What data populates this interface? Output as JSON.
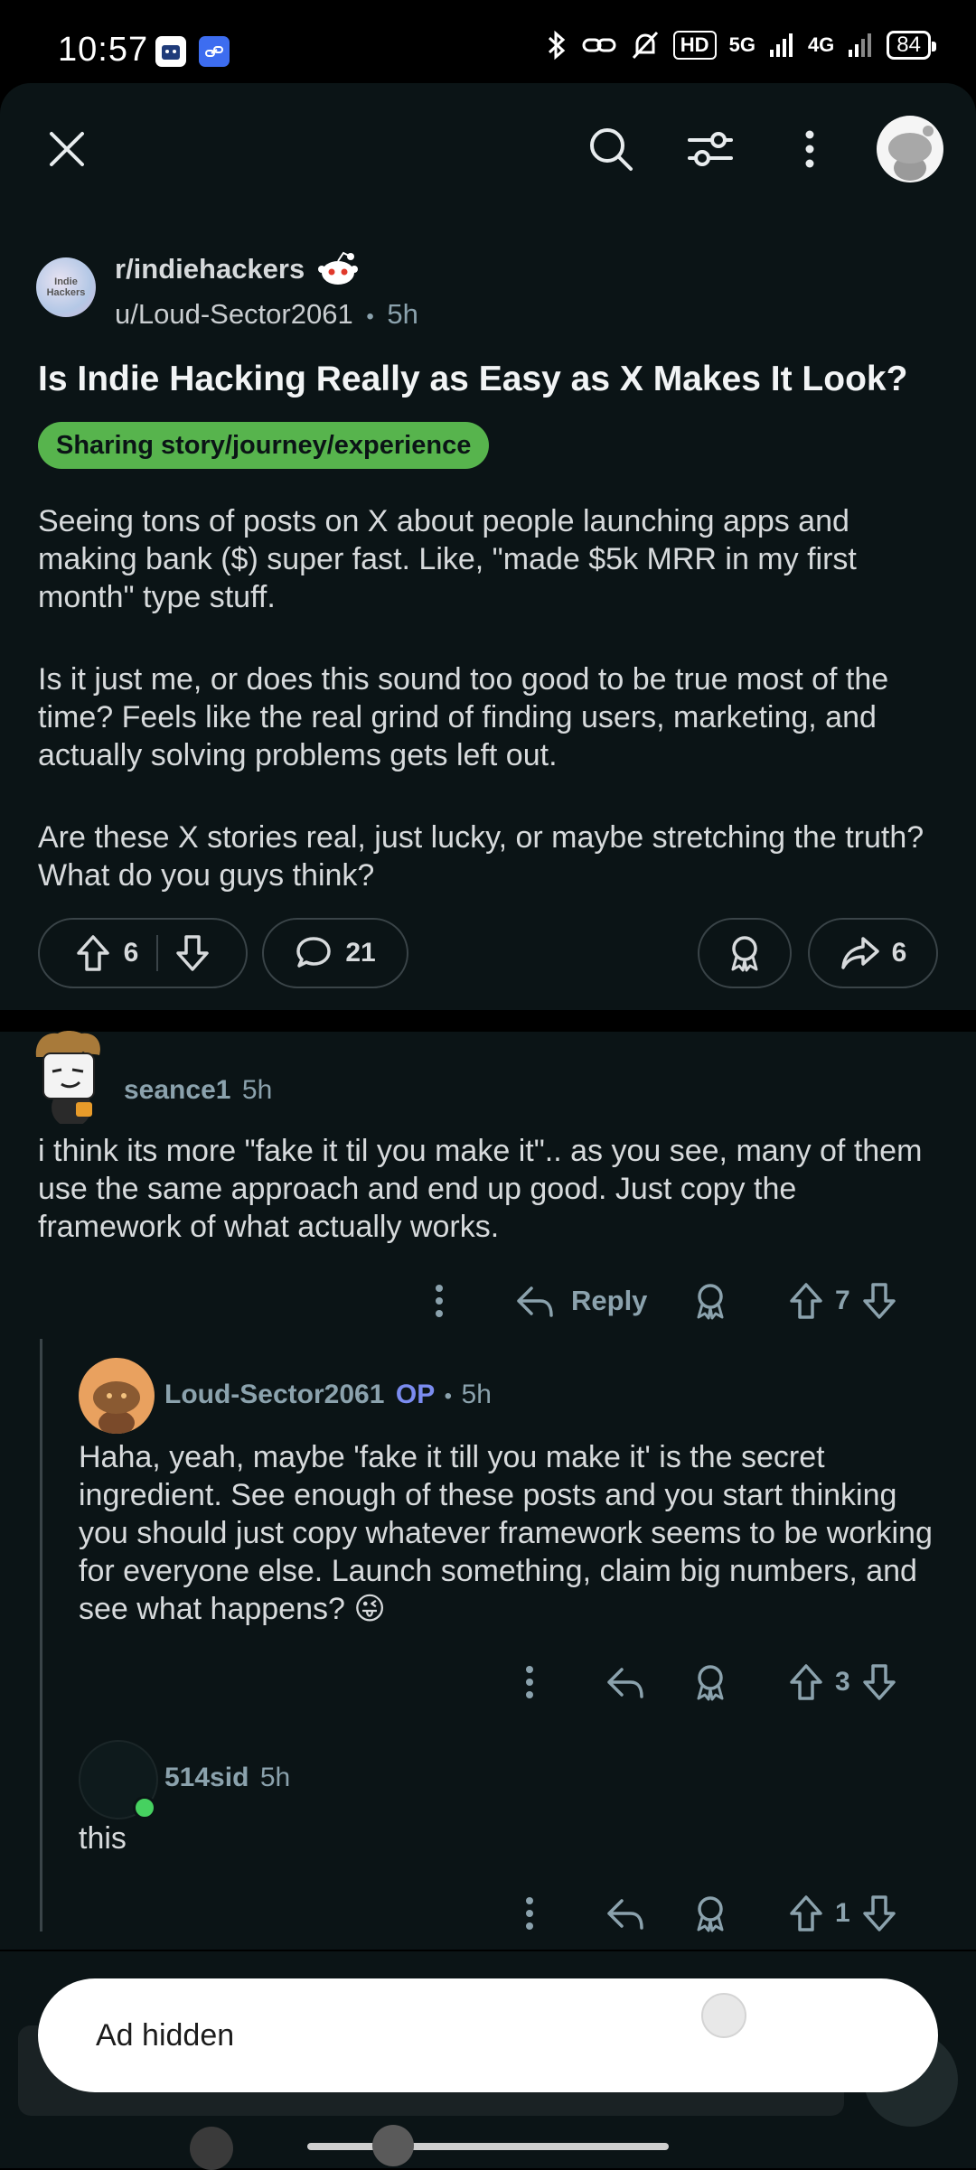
{
  "status": {
    "time": "10:57",
    "hd": "HD",
    "net1": "5G",
    "net2": "4G",
    "battery": "84"
  },
  "post": {
    "subreddit": "r/indiehackers",
    "sub_avatar_text": "Indie Hackers",
    "author": "u/Loud-Sector2061",
    "separator": "•",
    "age": "5h",
    "title": "Is Indie Hacking Really as Easy as X Makes It Look?",
    "flair": "Sharing story/journey/experience",
    "flair_color": "#57b44d",
    "body": [
      "Seeing tons of posts on X about people launching apps and making bank ($) super fast. Like, \"made $5k MRR in my first month\" type stuff.",
      "Is it just me, or does this sound too good to be true most of the time? Feels like the real grind of finding users, marketing, and actually solving problems gets left out.",
      "Are these X stories real, just lucky, or maybe stretching the truth? What do you guys think?"
    ],
    "votes": "6",
    "comments": "21",
    "shares": "6"
  },
  "comments": [
    {
      "user": "seance1",
      "age": "5h",
      "text": "i think its more \"fake it til you make it\".. as you see, many of them use the same approach and end up good. Just copy the framework of what actually works.",
      "reply_label": "Reply",
      "votes": "7"
    },
    {
      "user": "Loud-Sector2061",
      "op_badge": "OP",
      "separator": "•",
      "age": "5h",
      "text": "Haha, yeah, maybe 'fake it till you make it' is the secret ingredient. See enough of these posts and you start thinking you should just copy whatever framework seems to be working for everyone else. Launch something, claim big numbers, and see what happens? 😜",
      "votes": "3"
    },
    {
      "user": "514sid",
      "age": "5h",
      "text": "this",
      "votes": "1"
    }
  ],
  "toast": {
    "text": "Ad hidden"
  },
  "icons": [
    "close-icon",
    "search-icon",
    "filter-icon",
    "more-icon",
    "upvote-icon",
    "downvote-icon",
    "comment-icon",
    "award-icon",
    "share-icon",
    "reply-icon"
  ],
  "colors": {
    "background": "#0b1416",
    "text": "#d7dadc",
    "muted": "#8ba2ad",
    "op": "#7b8cf0",
    "online": "#46d160"
  }
}
